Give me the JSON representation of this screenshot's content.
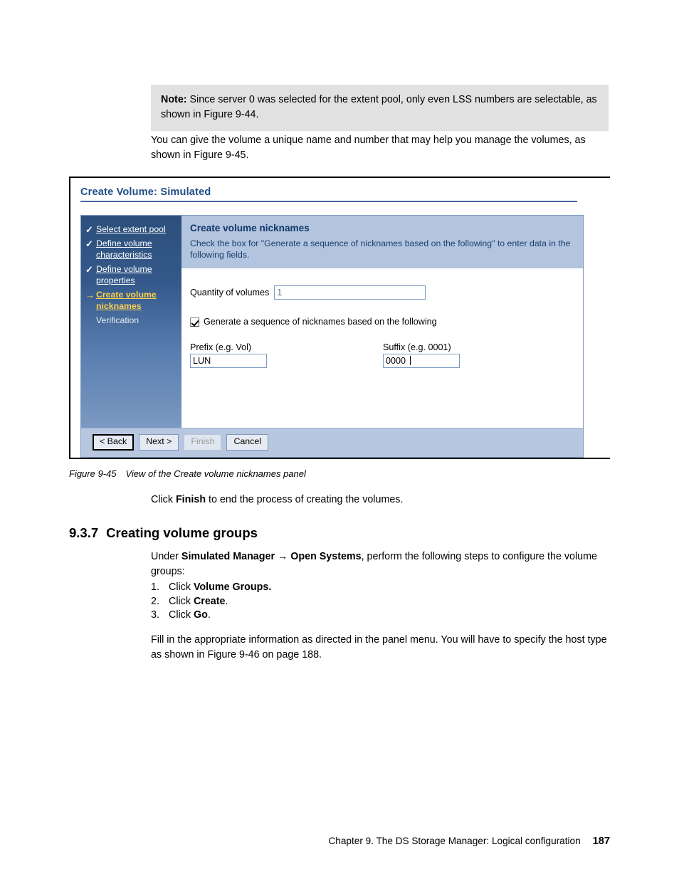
{
  "note": {
    "label": "Note:",
    "text": " Since server 0 was selected for the extent pool, only even LSS numbers are selectable, as shown in Figure 9-44."
  },
  "intro_paragraph": "You can give the volume a unique name and number that may help you manage the volumes, as shown in Figure 9-45.",
  "figure": {
    "app_title": "Create Volume: Simulated",
    "wizard_steps": [
      {
        "marker": "✓",
        "marker_type": "check",
        "label": "Select extent pool",
        "state": "completed"
      },
      {
        "marker": "✓",
        "marker_type": "check",
        "label": "Define volume characteristics",
        "state": "completed"
      },
      {
        "marker": "✓",
        "marker_type": "check",
        "label": "Define volume properties",
        "state": "completed"
      },
      {
        "marker": "→",
        "marker_type": "arrow",
        "label": "Create volume nicknames",
        "state": "current"
      },
      {
        "marker": "",
        "marker_type": "none",
        "label": "Verification",
        "state": "pending"
      }
    ],
    "content": {
      "title": "Create volume nicknames",
      "description": "Check the box for \"Generate a sequence of nicknames based on the following\" to enter data in the following fields.",
      "quantity_label": "Quantity of volumes",
      "quantity_value": "1",
      "generate_checkbox_label": "Generate a sequence of nicknames based on the following",
      "generate_checkbox_checked": "true",
      "prefix_caption": "Prefix (e.g. Vol)",
      "prefix_value": "LUN",
      "suffix_caption": "Suffix (e.g. 0001)",
      "suffix_value": "0000"
    },
    "buttons": {
      "back": "< Back",
      "next": "Next >",
      "finish": "Finish",
      "cancel": "Cancel"
    },
    "caption_number": "Figure 9-45",
    "caption_text": "View of the Create volume nicknames panel"
  },
  "post_figure_paragraph": {
    "before": "Click ",
    "bold": "Finish",
    "after": " to end the process of creating the volumes."
  },
  "section": {
    "number": "9.3.7",
    "title": "Creating volume groups"
  },
  "under_paragraph": {
    "p1": "Under ",
    "b1": "Simulated Manager",
    "arrow": " → ",
    "b2": "Open Systems",
    "p2": ", perform the following steps to configure the volume groups:"
  },
  "steps": [
    {
      "number": "1.",
      "before": "Click ",
      "bold": "Volume Groups.",
      "after": ""
    },
    {
      "number": "2.",
      "before": "Click ",
      "bold": "Create",
      "after": "."
    },
    {
      "number": "3.",
      "before": "Click ",
      "bold": "Go",
      "after": "."
    }
  ],
  "fill_paragraph": "Fill in the appropriate information as directed in the panel menu. You will have to specify the host type as shown in Figure 9-46 on page 188.",
  "footer": {
    "chapter": "Chapter 9. The DS Storage Manager: Logical configuration",
    "page_number": "187"
  },
  "colors": {
    "note_background": "#e1e1e1",
    "sidebar_top": "#2c4f7c",
    "sidebar_bottom": "#7b99c2",
    "content_header": "#b2c4de",
    "button_bar": "#b8c7e0",
    "title_blue": "#1f4e87",
    "current_step_yellow": "#ffd24d"
  }
}
